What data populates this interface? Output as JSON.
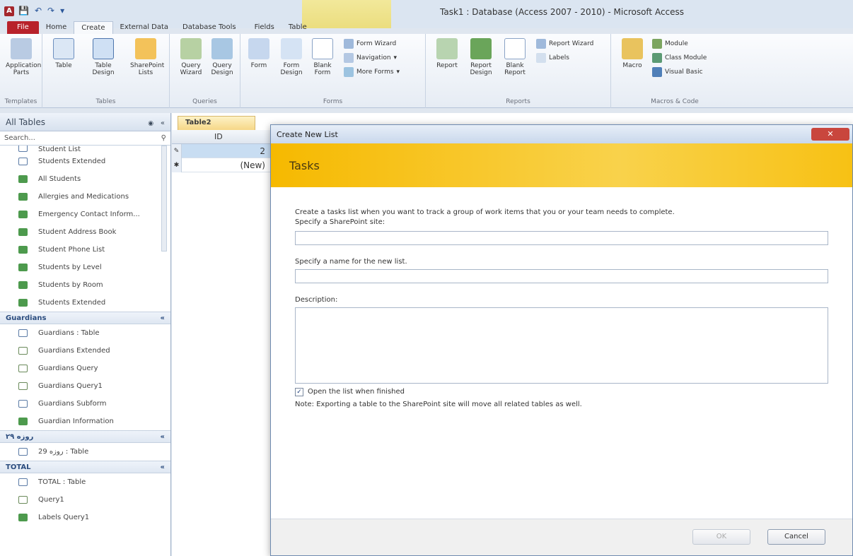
{
  "title_bar": {
    "window_title": "Task1 : Database (Access 2007 - 2010) - Microsoft Access",
    "app_letter": "A"
  },
  "ribbon_tabs": [
    "File",
    "Home",
    "Create",
    "External Data",
    "Database Tools",
    "Fields",
    "Table"
  ],
  "ribbon": {
    "templates": {
      "label": "Templates",
      "btn": "Application Parts"
    },
    "tables": {
      "label": "Tables",
      "btn1": "Table",
      "btn2": "Table Design",
      "btn3": "SharePoint Lists"
    },
    "queries": {
      "label": "Queries",
      "btn1": "Query Wizard",
      "btn2": "Query Design"
    },
    "forms": {
      "label": "Forms",
      "btn1": "Form",
      "btn2": "Form Design",
      "btn3": "Blank Form",
      "s1": "Form Wizard",
      "s2": "Navigation",
      "s3": "More Forms"
    },
    "reports": {
      "label": "Reports",
      "btn1": "Report",
      "btn2": "Report Design",
      "btn3": "Blank Report",
      "s1": "Report Wizard",
      "s2": "Labels"
    },
    "macros": {
      "label": "Macros & Code",
      "btn1": "Macro",
      "s1": "Module",
      "s2": "Class Module",
      "s3": "Visual Basic"
    }
  },
  "nav": {
    "header": "All Tables",
    "search_placeholder": "Search...",
    "items_top": [
      "Student List",
      "Students Extended",
      "All Students",
      "Allergies and Medications",
      "Emergency Contact Inform...",
      "Student Address Book",
      "Student Phone List",
      "Students by Level",
      "Students by Room",
      "Students Extended"
    ],
    "group_guardians": "Guardians",
    "items_guardians": [
      "Guardians : Table",
      "Guardians Extended",
      "Guardians Query",
      "Guardians Query1",
      "Guardians Subform",
      "Guardian Information"
    ],
    "group_ruzeh": "روزه ۲۹",
    "items_ruzeh": [
      "روزه 29 : Table"
    ],
    "group_total": "TOTAL",
    "items_total": [
      "TOTAL : Table",
      "Query1",
      "Labels Query1"
    ]
  },
  "document": {
    "tab": "Table2",
    "col_id": "ID",
    "row1_val": "2",
    "row2_val": "(New)"
  },
  "dialog": {
    "title": "Create New List",
    "banner": "Tasks",
    "intro": "Create a tasks list when you want to track a group of work items that you or your team needs to complete.",
    "site_label": "Specify a SharePoint site:",
    "site_value": "",
    "name_label": "Specify a name for the new list.",
    "name_value": "",
    "desc_label": "Description:",
    "desc_value": "",
    "open_label": "Open the list when finished",
    "note": "Note: Exporting a table to the SharePoint site will move all related tables as well.",
    "ok": "OK",
    "cancel": "Cancel"
  }
}
